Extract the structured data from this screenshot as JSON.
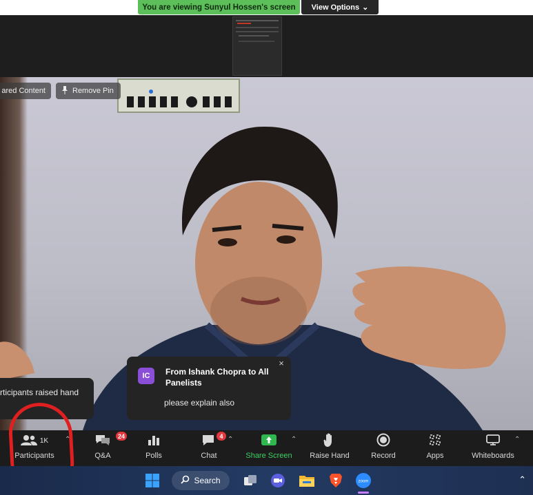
{
  "banner": {
    "viewing_text": "You are viewing Sunyul Hossen's screen",
    "view_options_label": "View Options"
  },
  "video": {
    "shared_content_label": "ared Content",
    "remove_pin_label": "Remove Pin"
  },
  "notifications": {
    "raised_hand_text": "rticipants raised hand",
    "chat": {
      "avatar_initials": "IC",
      "title": "From Ishank Chopra to All Panelists",
      "message": "please explain also"
    }
  },
  "toolbar": {
    "participants": {
      "label": "Participants",
      "count": "1K"
    },
    "qa": {
      "label": "Q&A",
      "badge": "24"
    },
    "polls": {
      "label": "Polls"
    },
    "chat": {
      "label": "Chat",
      "badge": "4"
    },
    "share_screen": {
      "label": "Share Screen"
    },
    "raise_hand": {
      "label": "Raise Hand"
    },
    "record": {
      "label": "Record"
    },
    "apps": {
      "label": "Apps"
    },
    "whiteboards": {
      "label": "Whiteboards"
    }
  },
  "taskbar": {
    "search_label": "Search",
    "zoom_label": "zoom"
  },
  "colors": {
    "banner_green": "#5dbf5a",
    "share_green": "#2fb84f",
    "badge_red": "#e0383e",
    "annotation_red": "#e02020",
    "avatar_purple": "#8a4fd6"
  }
}
